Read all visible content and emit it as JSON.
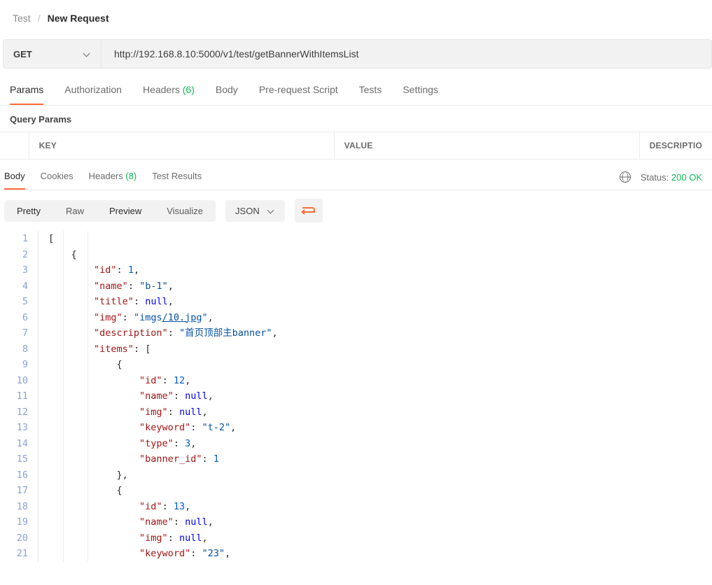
{
  "breadcrumb": {
    "root": "Test",
    "current": "New Request"
  },
  "request": {
    "method": "GET",
    "url": "http://192.168.8.10:5000/v1/test/getBannerWithItemsList"
  },
  "tabs": {
    "params": "Params",
    "auth": "Authorization",
    "headers_label": "Headers",
    "headers_count": "(6)",
    "body": "Body",
    "pre": "Pre-request Script",
    "tests": "Tests",
    "settings": "Settings"
  },
  "params_section_title": "Query Params",
  "params_table": {
    "key": "KEY",
    "value": "VALUE",
    "desc": "DESCRIPTIO"
  },
  "response_tabs": {
    "body": "Body",
    "cookies": "Cookies",
    "headers_label": "Headers",
    "headers_count": "(8)",
    "tests": "Test Results"
  },
  "status": {
    "label": "Status:",
    "code": "200 OK"
  },
  "view": {
    "pretty": "Pretty",
    "raw": "Raw",
    "preview": "Preview",
    "visualize": "Visualize",
    "lang": "JSON"
  },
  "code": {
    "line_start": 1,
    "line_end": 21,
    "tokens": [
      [
        [
          "p",
          "["
        ]
      ],
      [
        [
          "ind",
          1
        ],
        [
          "p",
          "{"
        ]
      ],
      [
        [
          "ind",
          2
        ],
        [
          "k",
          "\"id\""
        ],
        [
          "p",
          ": "
        ],
        [
          "n",
          "1"
        ],
        [
          "p",
          ","
        ]
      ],
      [
        [
          "ind",
          2
        ],
        [
          "k",
          "\"name\""
        ],
        [
          "p",
          ": "
        ],
        [
          "s",
          "\"b-1\""
        ],
        [
          "p",
          ","
        ]
      ],
      [
        [
          "ind",
          2
        ],
        [
          "k",
          "\"title\""
        ],
        [
          "p",
          ": "
        ],
        [
          "nl",
          "null"
        ],
        [
          "p",
          ","
        ]
      ],
      [
        [
          "ind",
          2
        ],
        [
          "k",
          "\"img\""
        ],
        [
          "p",
          ": "
        ],
        [
          "s",
          "\"imgs"
        ],
        [
          "su",
          "/10.jpg"
        ],
        [
          "s",
          "\""
        ],
        [
          "p",
          ","
        ]
      ],
      [
        [
          "ind",
          2
        ],
        [
          "k",
          "\"description\""
        ],
        [
          "p",
          ": "
        ],
        [
          "s",
          "\"首页顶部主banner\""
        ],
        [
          "p",
          ","
        ]
      ],
      [
        [
          "ind",
          2
        ],
        [
          "k",
          "\"items\""
        ],
        [
          "p",
          ": ["
        ]
      ],
      [
        [
          "ind",
          3
        ],
        [
          "p",
          "{"
        ]
      ],
      [
        [
          "ind",
          4
        ],
        [
          "k",
          "\"id\""
        ],
        [
          "p",
          ": "
        ],
        [
          "n",
          "12"
        ],
        [
          "p",
          ","
        ]
      ],
      [
        [
          "ind",
          4
        ],
        [
          "k",
          "\"name\""
        ],
        [
          "p",
          ": "
        ],
        [
          "nl",
          "null"
        ],
        [
          "p",
          ","
        ]
      ],
      [
        [
          "ind",
          4
        ],
        [
          "k",
          "\"img\""
        ],
        [
          "p",
          ": "
        ],
        [
          "nl",
          "null"
        ],
        [
          "p",
          ","
        ]
      ],
      [
        [
          "ind",
          4
        ],
        [
          "k",
          "\"keyword\""
        ],
        [
          "p",
          ": "
        ],
        [
          "s",
          "\"t-2\""
        ],
        [
          "p",
          ","
        ]
      ],
      [
        [
          "ind",
          4
        ],
        [
          "k",
          "\"type\""
        ],
        [
          "p",
          ": "
        ],
        [
          "n",
          "3"
        ],
        [
          "p",
          ","
        ]
      ],
      [
        [
          "ind",
          4
        ],
        [
          "k",
          "\"banner_id\""
        ],
        [
          "p",
          ": "
        ],
        [
          "n",
          "1"
        ]
      ],
      [
        [
          "ind",
          3
        ],
        [
          "p",
          "},"
        ]
      ],
      [
        [
          "ind",
          3
        ],
        [
          "p",
          "{"
        ]
      ],
      [
        [
          "ind",
          4
        ],
        [
          "k",
          "\"id\""
        ],
        [
          "p",
          ": "
        ],
        [
          "n",
          "13"
        ],
        [
          "p",
          ","
        ]
      ],
      [
        [
          "ind",
          4
        ],
        [
          "k",
          "\"name\""
        ],
        [
          "p",
          ": "
        ],
        [
          "nl",
          "null"
        ],
        [
          "p",
          ","
        ]
      ],
      [
        [
          "ind",
          4
        ],
        [
          "k",
          "\"img\""
        ],
        [
          "p",
          ": "
        ],
        [
          "nl",
          "null"
        ],
        [
          "p",
          ","
        ]
      ],
      [
        [
          "ind",
          4
        ],
        [
          "k",
          "\"keyword\""
        ],
        [
          "p",
          ": "
        ],
        [
          "s",
          "\"23\""
        ],
        [
          "p",
          ","
        ]
      ]
    ]
  }
}
